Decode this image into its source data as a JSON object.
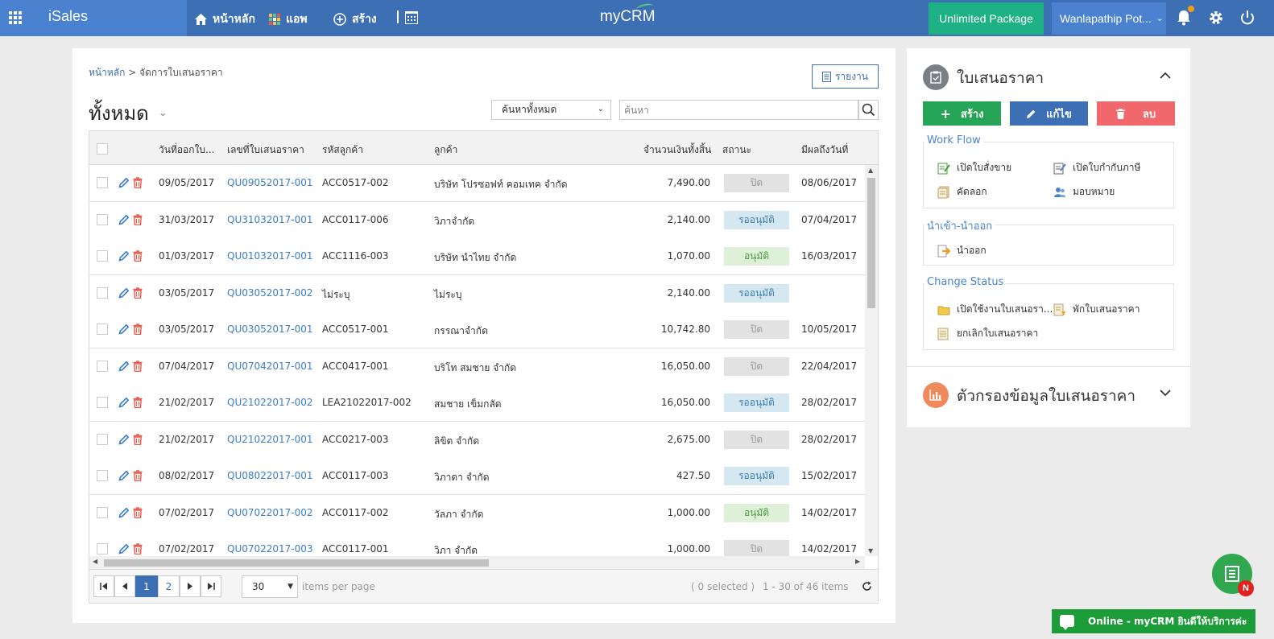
{
  "topbar": {
    "brand": "iSales",
    "nav": [
      {
        "label": "หน้าหลัก"
      },
      {
        "label": "แอพ"
      },
      {
        "label": "สร้าง"
      }
    ],
    "logo": "myCRM",
    "package_label": "Unlimited Package",
    "user_label": "Wanlapathip Pot...",
    "colors": {
      "bar": "#3c6fb4",
      "brand": "#4a82cf",
      "package": "#1eb184"
    }
  },
  "breadcrumb": {
    "home": "หน้าหลัก",
    "sep": ">",
    "current": "จัดการใบเสนอราคา"
  },
  "report_label": "รายงาน",
  "page_title": "ทั้งหมด",
  "search": {
    "scope": "ค้นหาทั้งหมด",
    "placeholder": "ค้นหา"
  },
  "table": {
    "columns": [
      "วันที่ออกใบ...",
      "เลขที่ใบเสนอราคา",
      "รหัสลูกค้า",
      "ลูกค้า",
      "จำนวนเงินทั้งสิ้น",
      "สถานะ",
      "มีผลถึงวันที่"
    ],
    "rows": [
      {
        "date": "09/05/2017",
        "quote_no": "QU09052017-001",
        "cust_code": "ACC0517-002",
        "customer": "บริษัท โปรซอฟท์ คอมเทค จำกัด",
        "amount": "7,490.00",
        "status": "ปิด",
        "status_kind": "closed",
        "valid_until": "08/06/2017"
      },
      {
        "date": "31/03/2017",
        "quote_no": "QU31032017-001",
        "cust_code": "ACC0117-006",
        "customer": "วิภาจำกัด",
        "amount": "2,140.00",
        "status": "รออนุมัติ",
        "status_kind": "pending",
        "valid_until": "07/04/2017"
      },
      {
        "date": "01/03/2017",
        "quote_no": "QU01032017-001",
        "cust_code": "ACC1116-003",
        "customer": "บริษัท นำไทย จำกัด",
        "amount": "1,070.00",
        "status": "อนุมัติ",
        "status_kind": "approved",
        "valid_until": "16/03/2017"
      },
      {
        "date": "03/05/2017",
        "quote_no": "QU03052017-002",
        "cust_code": "ไม่ระบุ",
        "customer": "ไม่ระบุ",
        "amount": "2,140.00",
        "status": "รออนุมัติ",
        "status_kind": "pending",
        "valid_until": ""
      },
      {
        "date": "03/05/2017",
        "quote_no": "QU03052017-001",
        "cust_code": "ACC0517-001",
        "customer": "กรรณาจำกัด",
        "amount": "10,742.80",
        "status": "ปิด",
        "status_kind": "closed",
        "valid_until": "10/05/2017"
      },
      {
        "date": "07/04/2017",
        "quote_no": "QU07042017-001",
        "cust_code": "ACC0417-001",
        "customer": "บริโท สมชาย จำกัด",
        "amount": "16,050.00",
        "status": "ปิด",
        "status_kind": "closed",
        "valid_until": "22/04/2017"
      },
      {
        "date": "21/02/2017",
        "quote_no": "QU21022017-002",
        "cust_code": "LEA21022017-002",
        "customer": "สมชาย เข็มกลัด",
        "amount": "16,050.00",
        "status": "รออนุมัติ",
        "status_kind": "pending",
        "valid_until": "28/02/2017"
      },
      {
        "date": "21/02/2017",
        "quote_no": "QU21022017-001",
        "cust_code": "ACC0217-003",
        "customer": "ลิขิต จำกัด",
        "amount": "2,675.00",
        "status": "ปิด",
        "status_kind": "closed",
        "valid_until": "28/02/2017"
      },
      {
        "date": "08/02/2017",
        "quote_no": "QU08022017-001",
        "cust_code": "ACC0117-003",
        "customer": "วิภาดา จำกัด",
        "amount": "427.50",
        "status": "รออนุมัติ",
        "status_kind": "pending",
        "valid_until": "15/02/2017"
      },
      {
        "date": "07/02/2017",
        "quote_no": "QU07022017-002",
        "cust_code": "ACC0117-002",
        "customer": "วัลภา จำกัด",
        "amount": "1,000.00",
        "status": "อนุมัติ",
        "status_kind": "approved",
        "valid_until": "14/02/2017"
      },
      {
        "date": "07/02/2017",
        "quote_no": "QU07022017-003",
        "cust_code": "ACC0117-001",
        "customer": "วิภา จำกัด",
        "amount": "1,000.00",
        "status": "ปิด",
        "status_kind": "closed",
        "valid_until": "14/02/2017"
      }
    ]
  },
  "pager": {
    "pages": [
      "1",
      "2"
    ],
    "current_page": "1",
    "per_page": "30",
    "per_page_label": "items per page",
    "selected": "( 0 selected )",
    "range": "1 - 30 of 46 items"
  },
  "side": {
    "title": "ใบเสนอราคา",
    "actions": {
      "create": "สร้าง",
      "edit": "แก้ไข",
      "delete": "ลบ"
    },
    "workflow": {
      "title": "Work Flow",
      "items": [
        "เปิดใบสั่งขาย",
        "เปิดใบกำกับภาษี",
        "คัดลอก",
        "มอบหมาย"
      ]
    },
    "import_export": {
      "title": "นำเข้า-นำออก",
      "items": [
        "นำออก"
      ]
    },
    "change_status": {
      "title": "Change Status",
      "items": [
        "เปิดใช้งานใบเสนอรา...",
        "พักใบเสนอราคา",
        "ยกเลิกใบเสนอราคา"
      ]
    },
    "filter_title": "ตัวกรองข้อมูลใบเสนอราคา",
    "colors": {
      "create": "#27a557",
      "edit": "#3c6fb4",
      "delete": "#f0686b"
    }
  },
  "floating": {
    "badge": "N",
    "chat_label": "Online - myCRM ยินดีให้บริการค่ะ"
  }
}
